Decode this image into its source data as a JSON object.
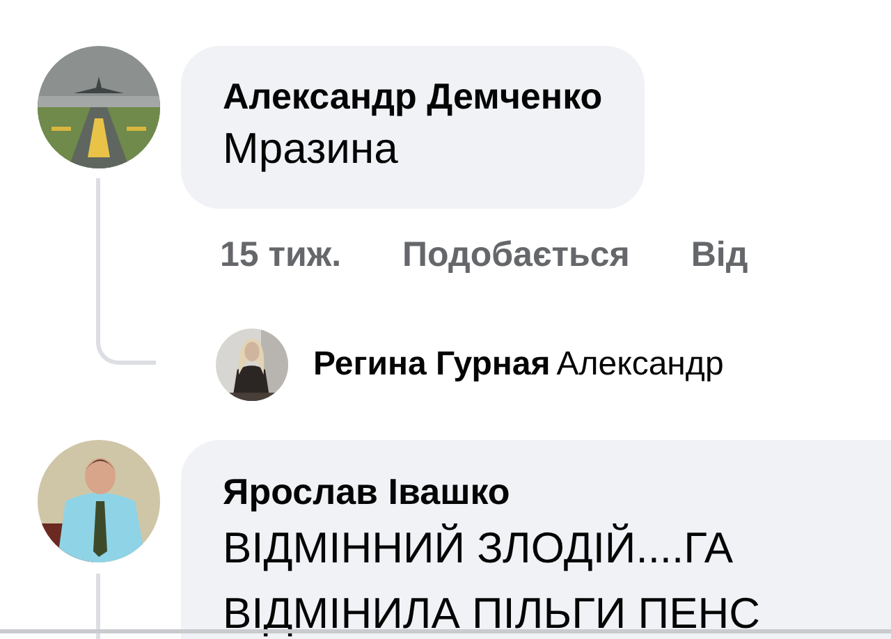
{
  "comments": [
    {
      "author": "Александр Демченко",
      "text": [
        "Мразина"
      ],
      "actions": [
        "15 тиж.",
        "Подобається",
        "Від"
      ],
      "replies": [
        {
          "author": "Регина Гурная",
          "text": "Александр"
        }
      ]
    },
    {
      "author": "Ярослав Івашко",
      "text": [
        "ВІДМІННИЙ ЗЛОДІЙ....ГА",
        "ВІДМІНИЛА ПІЛЬГИ ПЕНС"
      ]
    }
  ]
}
